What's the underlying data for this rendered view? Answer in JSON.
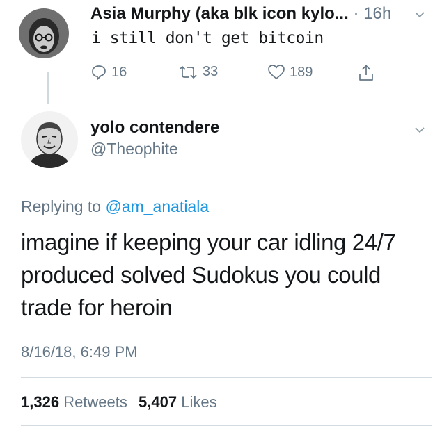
{
  "parent_tweet": {
    "display_name": "Asia Murphy (aka blk icon kylo...",
    "separator": "·",
    "time_ago": "16h",
    "text": "i still don't get bitcoin",
    "reply_count": "16",
    "retweet_count": "33",
    "like_count": "189"
  },
  "main_tweet": {
    "display_name": "yolo contendere",
    "handle": "@Theophite",
    "replying_prefix": "Replying to",
    "replying_to": "@am_anatiala",
    "body_lines": [
      "imagine if keeping your car idling 24/7",
      "produced solved Sudokus you could",
      "trade for heroin"
    ],
    "timestamp": "8/16/18, 6:49 PM",
    "retweets_count": "1,326",
    "retweets_label": "Retweets",
    "likes_count": "5,407",
    "likes_label": "Likes"
  },
  "colors": {
    "text": "#14171a",
    "secondary": "#657786",
    "link": "#1b95e0",
    "divider": "#d4dbe0"
  },
  "icons": [
    "reply-icon",
    "retweet-icon",
    "like-icon",
    "share-icon",
    "chevron-down-icon"
  ]
}
